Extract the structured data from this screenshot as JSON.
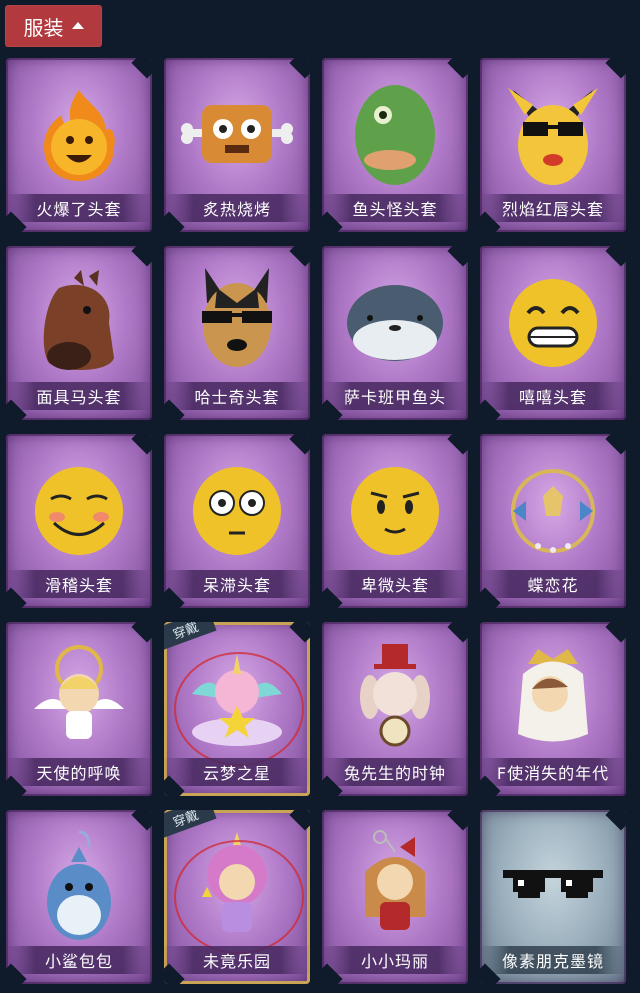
{
  "header": {
    "title": "服装"
  },
  "equipped_badge": "穿戴",
  "items": [
    {
      "label": "火爆了头套",
      "icon": "fire-mask-icon",
      "theme": "purple",
      "equipped": false
    },
    {
      "label": "炙热烧烤",
      "icon": "bbq-block-icon",
      "theme": "purple",
      "equipped": false
    },
    {
      "label": "鱼头怪头套",
      "icon": "fish-head-mask-icon",
      "theme": "purple",
      "equipped": false
    },
    {
      "label": "烈焰红唇头套",
      "icon": "yellow-mask-sunglasses-icon",
      "theme": "purple",
      "equipped": false
    },
    {
      "label": "面具马头套",
      "icon": "horse-mask-icon",
      "theme": "purple",
      "equipped": false
    },
    {
      "label": "哈士奇头套",
      "icon": "husky-mask-icon",
      "theme": "purple",
      "equipped": false
    },
    {
      "label": "萨卡班甲鱼头",
      "icon": "sacabambaspis-head-icon",
      "theme": "purple",
      "equipped": false
    },
    {
      "label": "嘻嘻头套",
      "icon": "grin-emoji-icon",
      "theme": "purple",
      "equipped": false
    },
    {
      "label": "滑稽头套",
      "icon": "funny-emoji-icon",
      "theme": "purple",
      "equipped": false
    },
    {
      "label": "呆滞头套",
      "icon": "dazed-emoji-icon",
      "theme": "purple",
      "equipped": false
    },
    {
      "label": "卑微头套",
      "icon": "humble-emoji-icon",
      "theme": "purple",
      "equipped": false
    },
    {
      "label": "蝶恋花",
      "icon": "butterfly-bell-wreath-icon",
      "theme": "purple",
      "equipped": false
    },
    {
      "label": "天使的呼唤",
      "icon": "angel-doll-icon",
      "theme": "purple",
      "equipped": false
    },
    {
      "label": "云梦之星",
      "icon": "unicorn-cloud-star-icon",
      "theme": "purple",
      "equipped": true
    },
    {
      "label": "兔先生的时钟",
      "icon": "rabbit-clock-icon",
      "theme": "purple",
      "equipped": false
    },
    {
      "label": "F使消失的年代",
      "icon": "veiled-girl-doll-icon",
      "theme": "purple",
      "equipped": false
    },
    {
      "label": "小鲨包包",
      "icon": "shark-bag-icon",
      "theme": "purple",
      "equipped": false
    },
    {
      "label": "未竟乐园",
      "icon": "pink-hair-girl-doll-icon",
      "theme": "purple",
      "equipped": true
    },
    {
      "label": "小小玛丽",
      "icon": "mary-doll-keychain-icon",
      "theme": "purple",
      "equipped": false
    },
    {
      "label": "像素朋克墨镜",
      "icon": "pixel-sunglasses-icon",
      "theme": "blue",
      "equipped": false
    }
  ]
}
